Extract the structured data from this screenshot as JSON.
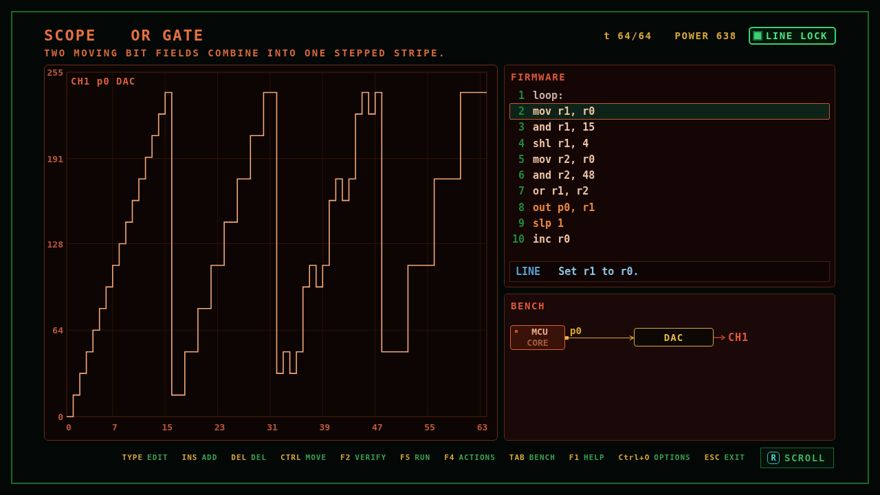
{
  "header": {
    "app": "SCOPE",
    "title": "OR GATE",
    "subtitle": "TWO MOVING BIT FIELDS COMBINE INTO ONE STEPPED STRIPE.",
    "time": "t 64/64",
    "power": "POWER 638",
    "line_lock": {
      "label": "LINE LOCK",
      "on": true
    }
  },
  "scope": {
    "chart_data": {
      "type": "line",
      "title": "CH1 p0 DAC",
      "x": [
        0,
        1,
        1,
        2,
        2,
        3,
        3,
        4,
        4,
        5,
        5,
        6,
        6,
        7,
        7,
        8,
        8,
        9,
        9,
        10,
        10,
        11,
        11,
        12,
        12,
        13,
        13,
        14,
        14,
        15,
        15,
        16,
        16,
        18,
        18,
        20,
        20,
        22,
        22,
        24,
        24,
        26,
        26,
        28,
        28,
        30,
        30,
        32,
        32,
        33,
        33,
        34,
        34,
        35,
        35,
        36,
        36,
        37,
        37,
        38,
        38,
        39,
        39,
        40,
        40,
        41,
        41,
        42,
        42,
        43,
        43,
        44,
        44,
        45,
        45,
        46,
        46,
        47,
        47,
        48,
        48,
        52,
        52,
        56,
        56,
        60,
        60,
        64
      ],
      "series": [
        {
          "color": "#f4a878",
          "values": [
            0,
            0,
            16,
            16,
            32,
            32,
            48,
            48,
            64,
            64,
            80,
            80,
            96,
            96,
            112,
            112,
            128,
            128,
            144,
            144,
            160,
            160,
            176,
            176,
            192,
            192,
            208,
            208,
            224,
            224,
            240,
            240,
            16,
            16,
            48,
            48,
            80,
            80,
            112,
            112,
            144,
            144,
            176,
            176,
            208,
            208,
            240,
            240,
            32,
            32,
            48,
            48,
            32,
            32,
            48,
            48,
            96,
            96,
            112,
            112,
            96,
            96,
            112,
            112,
            160,
            160,
            176,
            176,
            160,
            160,
            176,
            176,
            224,
            224,
            240,
            240,
            224,
            224,
            240,
            240,
            48,
            48,
            112,
            112,
            176,
            176,
            240,
            240
          ]
        }
      ],
      "xlim": [
        0,
        64
      ],
      "ylim": [
        0,
        255
      ],
      "xticks": [
        0,
        7,
        15,
        23,
        31,
        39,
        47,
        55,
        63
      ],
      "yticks": [
        0,
        64,
        128,
        191,
        255
      ],
      "grid": true
    }
  },
  "firmware": {
    "title": "FIRMWARE",
    "lines": [
      {
        "number": "1",
        "code": "loop:",
        "kind": "label",
        "selected": false
      },
      {
        "number": "2",
        "code": "mov r1, r0",
        "kind": "op",
        "selected": true
      },
      {
        "number": "3",
        "code": "and r1, 15",
        "kind": "op",
        "selected": false
      },
      {
        "number": "4",
        "code": "shl r1, 4",
        "kind": "op",
        "selected": false
      },
      {
        "number": "5",
        "code": "mov r2, r0",
        "kind": "op",
        "selected": false
      },
      {
        "number": "6",
        "code": "and r2, 48",
        "kind": "op",
        "selected": false
      },
      {
        "number": "7",
        "code": "or r1, r2",
        "kind": "op",
        "selected": false
      },
      {
        "number": "8",
        "code": "out p0, r1",
        "kind": "io",
        "selected": false
      },
      {
        "number": "9",
        "code": "slp 1",
        "kind": "io",
        "selected": false
      },
      {
        "number": "10",
        "code": "inc r0",
        "kind": "op",
        "selected": false
      }
    ],
    "info": {
      "label": "LINE",
      "text": "Set r1 to r0."
    }
  },
  "bench": {
    "title": "BENCH",
    "source": {
      "name": "MCU",
      "detail": "CORE"
    },
    "port": "p0",
    "target": "DAC",
    "output": "CH1"
  },
  "footer": {
    "hints": [
      {
        "key": "TYPE",
        "action": "EDIT"
      },
      {
        "key": "INS",
        "action": "ADD"
      },
      {
        "key": "DEL",
        "action": "DEL"
      },
      {
        "key": "CTRL",
        "action": "MOVE"
      },
      {
        "key": "F2",
        "action": "VERIFY"
      },
      {
        "key": "F5",
        "action": "RUN"
      },
      {
        "key": "F4",
        "action": "ACTIONS"
      },
      {
        "key": "TAB",
        "action": "BENCH"
      },
      {
        "key": "F1",
        "action": "HELP"
      },
      {
        "key": "Ctrl+O",
        "action": "OPTIONS"
      },
      {
        "key": "ESC",
        "action": "EXIT"
      }
    ],
    "scroll": {
      "key": "R",
      "label": "SCROLL"
    }
  }
}
